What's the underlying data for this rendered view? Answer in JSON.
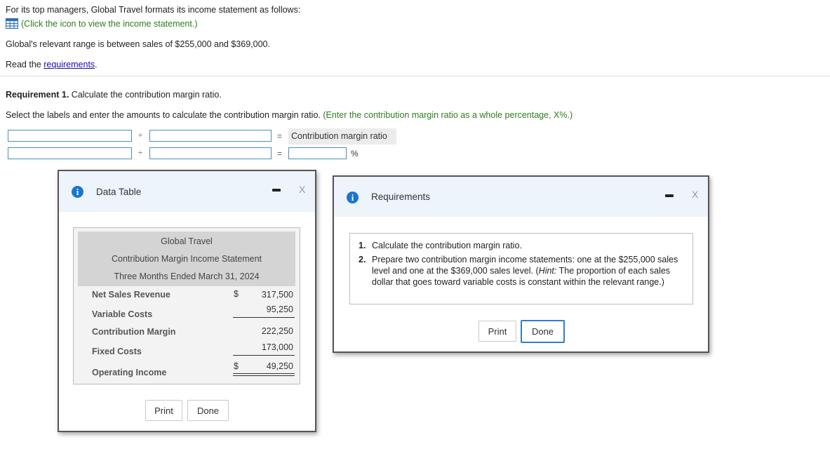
{
  "intro": {
    "line1": "For its top managers, Global Travel formats its income statement as follows:",
    "icon_link": "(Click the icon to view the income statement.)",
    "relevant_range": "Global's relevant range is between sales of $255,000 and $369,000.",
    "read_prefix": "Read the ",
    "requirements_link": "requirements",
    "read_suffix": "."
  },
  "requirement1": {
    "heading_bold": "Requirement 1.",
    "heading_rest": " Calculate the contribution margin ratio.",
    "instruction": "Select the labels and enter the amounts to calculate the contribution margin ratio.",
    "instruction_hint": "(Enter the contribution margin ratio as a whole percentage, X%.)",
    "divide_symbol": "÷",
    "equals_symbol": "=",
    "result_label": "Contribution margin ratio",
    "percent_symbol": "%"
  },
  "data_table_dialog": {
    "title": "Data Table",
    "info_glyph": "i",
    "close_glyph": "X",
    "statement": {
      "company": "Global Travel",
      "name": "Contribution Margin Income Statement",
      "period": "Three Months Ended March 31, 2024",
      "rows": [
        {
          "label": "Net Sales Revenue",
          "dollar": "$",
          "value": "317,500"
        },
        {
          "label": "Variable Costs",
          "dollar": "",
          "value": "95,250"
        },
        {
          "label": "Contribution Margin",
          "dollar": "",
          "value": "222,250"
        },
        {
          "label": "Fixed Costs",
          "dollar": "",
          "value": "173,000"
        },
        {
          "label": "Operating Income",
          "dollar": "$",
          "value": "49,250"
        }
      ]
    },
    "print_label": "Print",
    "done_label": "Done"
  },
  "requirements_dialog": {
    "title": "Requirements",
    "info_glyph": "i",
    "close_glyph": "X",
    "items": [
      {
        "num": "1.",
        "text": "Calculate the contribution margin ratio."
      },
      {
        "num": "2.",
        "text_before_hint": "Prepare two contribution margin income statements: one at the $255,000 sales level and one at the $369,000 sales level. (",
        "hint_word": "Hint:",
        "text_after_hint": " The proportion of each sales dollar that goes toward variable costs is constant within the relevant range.)"
      }
    ],
    "print_label": "Print",
    "done_label": "Done"
  },
  "colors": {
    "accent_green": "#2e7d1e",
    "link_blue": "#1a0dab",
    "input_border": "#4b8fb8",
    "info_blue": "#1b75d0",
    "dialog_header": "#eef4fb"
  }
}
